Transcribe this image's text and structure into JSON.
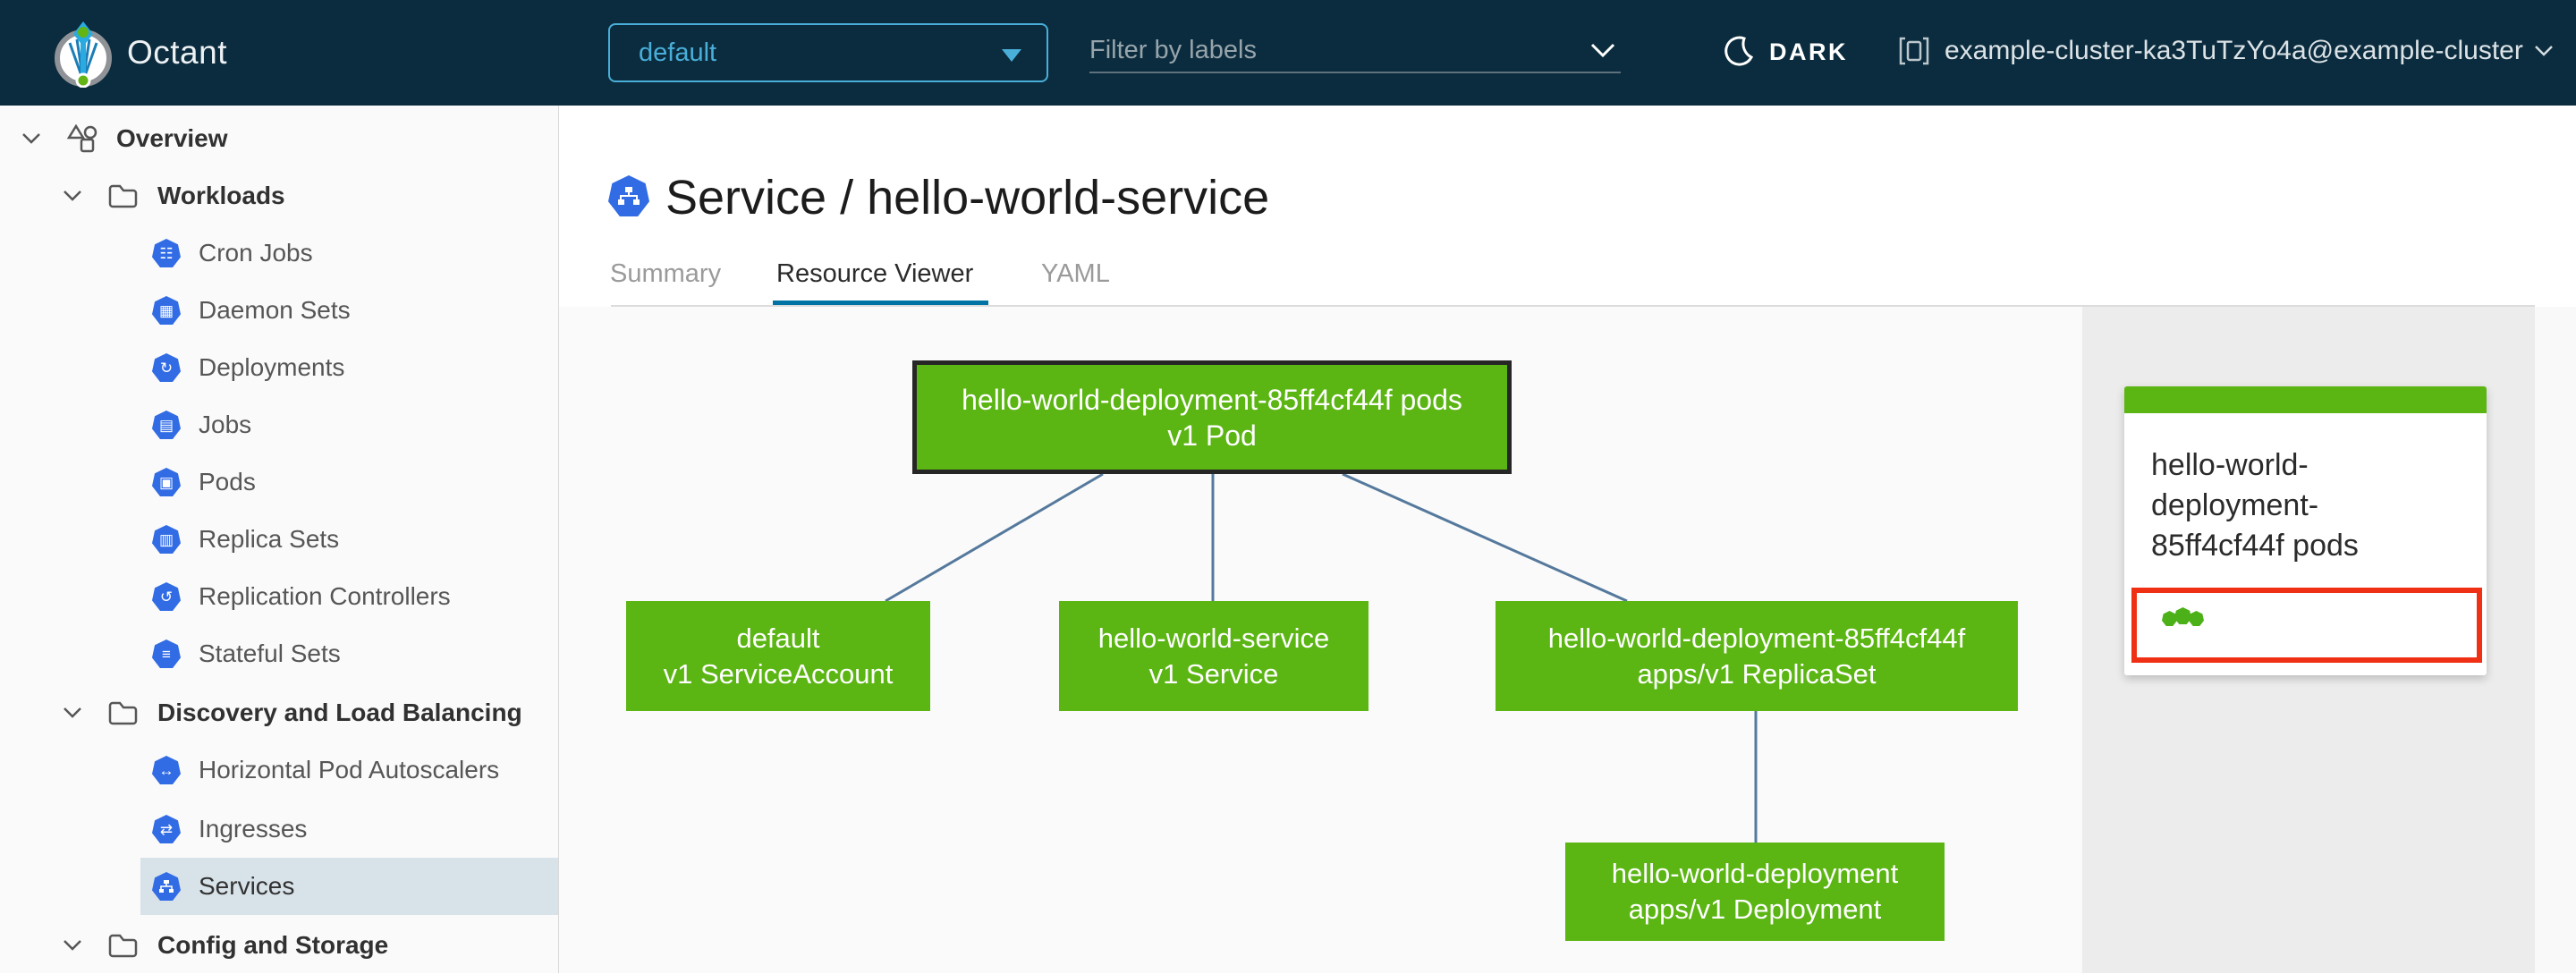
{
  "app": {
    "name": "Octant",
    "theme_toggle_label": "DARK"
  },
  "header": {
    "namespace_selected": "default",
    "filter_placeholder": "Filter by labels",
    "cluster_context": "example-cluster-ka3TuTzYo4a@example-cluster"
  },
  "sidebar": {
    "items": [
      {
        "label": "Overview"
      },
      {
        "label": "Workloads"
      },
      {
        "label": "Cron Jobs"
      },
      {
        "label": "Daemon Sets"
      },
      {
        "label": "Deployments"
      },
      {
        "label": "Jobs"
      },
      {
        "label": "Pods"
      },
      {
        "label": "Replica Sets"
      },
      {
        "label": "Replication Controllers"
      },
      {
        "label": "Stateful Sets"
      },
      {
        "label": "Discovery and Load Balancing"
      },
      {
        "label": "Horizontal Pod Autoscalers"
      },
      {
        "label": "Ingresses"
      },
      {
        "label": "Services"
      },
      {
        "label": "Config and Storage"
      }
    ],
    "selected_item": "Services"
  },
  "page": {
    "title": "Service / hello-world-service",
    "tabs": [
      {
        "label": "Summary",
        "active": false
      },
      {
        "label": "Resource Viewer",
        "active": true
      },
      {
        "label": "YAML",
        "active": false
      }
    ]
  },
  "graph": {
    "nodes": [
      {
        "name": "hello-world-deployment-85ff4cf44f pods",
        "kind": "v1 Pod",
        "selected": true
      },
      {
        "name": "default",
        "kind": "v1 ServiceAccount",
        "selected": false
      },
      {
        "name": "hello-world-service",
        "kind": "v1 Service",
        "selected": false
      },
      {
        "name": "hello-world-deployment-85ff4cf44f",
        "kind": "apps/v1 ReplicaSet",
        "selected": false
      },
      {
        "name": "hello-world-deployment",
        "kind": "apps/v1 Deployment",
        "selected": false
      }
    ],
    "edges": [
      {
        "from": "v1 Pod",
        "to": "v1 ServiceAccount"
      },
      {
        "from": "v1 Pod",
        "to": "v1 Service"
      },
      {
        "from": "v1 Pod",
        "to": "apps/v1 ReplicaSet"
      },
      {
        "from": "apps/v1 ReplicaSet",
        "to": "apps/v1 Deployment"
      }
    ]
  },
  "detail_panel": {
    "card_title": "hello-world-deployment-85ff4cf44f pods",
    "status_ok_count": 3
  },
  "colors": {
    "header_bg": "#0b2c3e",
    "accent_blue": "#49afd9",
    "k8s_blue": "#326ce5",
    "node_green": "#5bb513",
    "edge_blue": "#55799c",
    "tab_underline": "#0072a3",
    "selected_nav_bg": "#d8e3e9",
    "highlight_red": "#f03014"
  }
}
